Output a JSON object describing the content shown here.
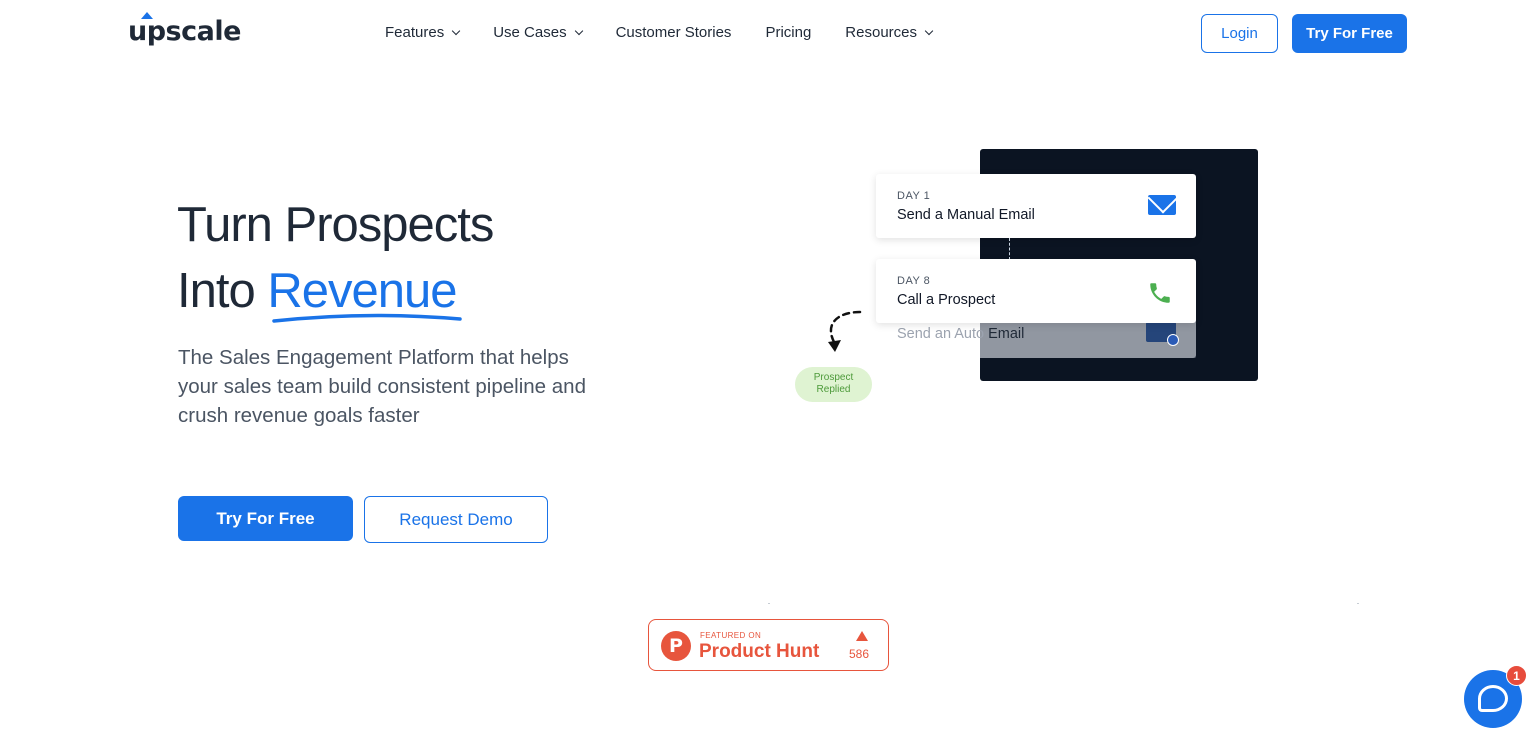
{
  "header": {
    "logo_text": "upscale",
    "nav": [
      {
        "label": "Features",
        "has_dropdown": true
      },
      {
        "label": "Use Cases",
        "has_dropdown": true
      },
      {
        "label": "Customer Stories",
        "has_dropdown": false
      },
      {
        "label": "Pricing",
        "has_dropdown": false
      },
      {
        "label": "Resources",
        "has_dropdown": true
      }
    ],
    "login_label": "Login",
    "try_label": "Try For Free"
  },
  "hero": {
    "title_line1": "Turn Prospects",
    "title_line2_prefix": "Into ",
    "title_line2_accent": "Revenue",
    "subtitle": "The Sales Engagement Platform that helps your sales team build consistent pipeline and crush revenue goals faster",
    "primary_cta": "Try For Free",
    "secondary_cta": "Request Demo"
  },
  "illustration": {
    "card1": {
      "day": "DAY 1",
      "task": "Send a Manual Email",
      "icon": "mail-icon"
    },
    "card2": {
      "day": "DAY 8",
      "task": "Call a Prospect",
      "icon": "phone-icon"
    },
    "card3": {
      "task_part1": "Send an Auto ",
      "task_part2": "Email",
      "icon": "mail-icon"
    },
    "replied_line1": "Prospect",
    "replied_line2": "Replied"
  },
  "product_hunt": {
    "small_text": "FEATURED ON",
    "name": "Product Hunt",
    "count": "586",
    "letter": "P"
  },
  "chat": {
    "badge_count": "1",
    "icon": "chat-bubble-icon"
  },
  "colors": {
    "brand_blue": "#1a73e8",
    "text_dark": "#1f2937",
    "product_hunt": "#e7553d",
    "panel_dark": "#0b1422"
  }
}
